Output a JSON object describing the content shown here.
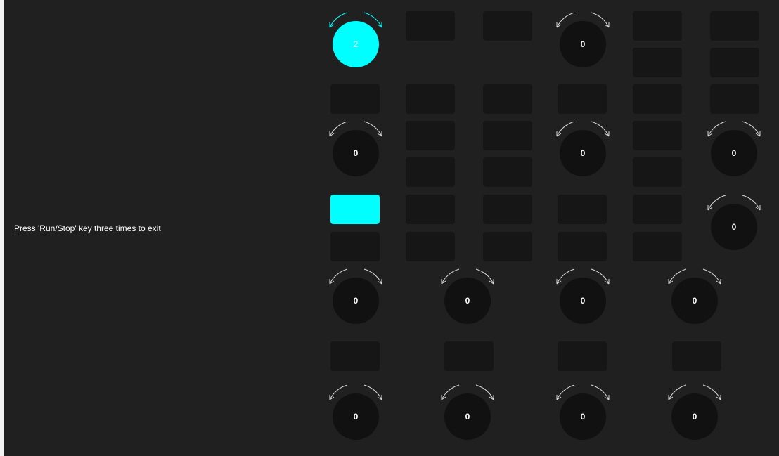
{
  "instruction": "Press 'Run/Stop' key three times to exit",
  "colors": {
    "background": "#202020",
    "key": "#161616",
    "knob": "#111111",
    "active": "#00ffff",
    "arrow": "#d8d8d8"
  },
  "knobs": [
    {
      "name": "knob-r1-c1",
      "value": "2",
      "active": true
    },
    {
      "name": "knob-r1-c4",
      "value": "0",
      "active": false
    },
    {
      "name": "knob-r2-c1",
      "value": "0",
      "active": false
    },
    {
      "name": "knob-r2-c4",
      "value": "0",
      "active": false
    },
    {
      "name": "knob-r2-c6",
      "value": "0",
      "active": false
    },
    {
      "name": "knob-r3-c6",
      "value": "0",
      "active": false
    },
    {
      "name": "knob-r4-c1",
      "value": "0",
      "active": false
    },
    {
      "name": "knob-r4-c2",
      "value": "0",
      "active": false
    },
    {
      "name": "knob-r4-c3",
      "value": "0",
      "active": false
    },
    {
      "name": "knob-r4-c4",
      "value": "0",
      "active": false
    },
    {
      "name": "knob-r5-c1",
      "value": "0",
      "active": false
    },
    {
      "name": "knob-r5-c2",
      "value": "0",
      "active": false
    },
    {
      "name": "knob-r5-c3",
      "value": "0",
      "active": false
    },
    {
      "name": "knob-r5-c4",
      "value": "0",
      "active": false
    }
  ],
  "keys": [
    {
      "name": "key-r1-c2",
      "active": false
    },
    {
      "name": "key-r1-c3",
      "active": false
    },
    {
      "name": "key-r1-c5a",
      "active": false
    },
    {
      "name": "key-r1-c6a",
      "active": false
    },
    {
      "name": "key-r1-c5b",
      "active": false
    },
    {
      "name": "key-r1-c6b",
      "active": false
    },
    {
      "name": "key-r2-c1",
      "active": false
    },
    {
      "name": "key-r2-c2a",
      "active": false
    },
    {
      "name": "key-r2-c3a",
      "active": false
    },
    {
      "name": "key-r2-c4",
      "active": false
    },
    {
      "name": "key-r2-c5a",
      "active": false
    },
    {
      "name": "key-r2-c6",
      "active": false
    },
    {
      "name": "key-r2-c2b",
      "active": false
    },
    {
      "name": "key-r2-c3b",
      "active": false
    },
    {
      "name": "key-r2-c5b",
      "active": false
    },
    {
      "name": "key-r2-c2c",
      "active": false
    },
    {
      "name": "key-r2-c3c",
      "active": false
    },
    {
      "name": "key-r2-c5c",
      "active": false
    },
    {
      "name": "key-r3-c1a",
      "active": true
    },
    {
      "name": "key-r3-c2a",
      "active": false
    },
    {
      "name": "key-r3-c3a",
      "active": false
    },
    {
      "name": "key-r3-c4a",
      "active": false
    },
    {
      "name": "key-r3-c5a",
      "active": false
    },
    {
      "name": "key-r3-c1b",
      "active": false
    },
    {
      "name": "key-r3-c2b",
      "active": false
    },
    {
      "name": "key-r3-c3b",
      "active": false
    },
    {
      "name": "key-r3-c4b",
      "active": false
    },
    {
      "name": "key-r3-c5b",
      "active": false
    },
    {
      "name": "key-r5-c1",
      "active": false
    },
    {
      "name": "key-r5-c2",
      "active": false
    },
    {
      "name": "key-r5-c3",
      "active": false
    },
    {
      "name": "key-r5-c4",
      "active": false
    }
  ]
}
